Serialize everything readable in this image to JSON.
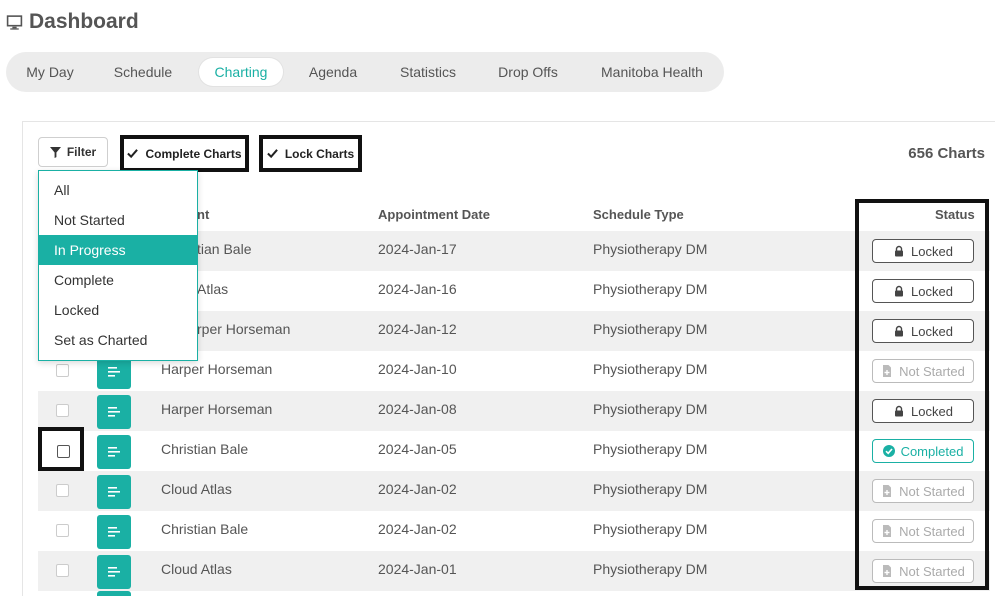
{
  "header": {
    "title": "Dashboard",
    "icon": "monitor-icon"
  },
  "tabs": [
    {
      "label": "My Day",
      "active": false
    },
    {
      "label": "Schedule",
      "active": false
    },
    {
      "label": "Charting",
      "active": true
    },
    {
      "label": "Agenda",
      "active": false
    },
    {
      "label": "Statistics",
      "active": false
    },
    {
      "label": "Drop Offs",
      "active": false
    },
    {
      "label": "Manitoba Health",
      "active": false
    }
  ],
  "toolbar": {
    "filter_label": "Filter",
    "complete_charts_label": "Complete Charts",
    "lock_charts_label": "Lock Charts",
    "chart_count": "656 Charts"
  },
  "filter_menu": {
    "options": [
      "All",
      "Not Started",
      "In Progress",
      "Complete",
      "Locked",
      "Set as Charted"
    ],
    "selected": "In Progress"
  },
  "table": {
    "columns": {
      "patient": "nt",
      "appointment_date": "Appointment Date",
      "schedule_type": "Schedule Type",
      "status": "Status"
    },
    "rows": [
      {
        "patient": "tian Bale",
        "date": "2024-Jan-17",
        "schedule": "Physiotherapy DM",
        "status": "Locked"
      },
      {
        "patient": "Atlas",
        "date": "2024-Jan-16",
        "schedule": "Physiotherapy DM",
        "status": "Locked"
      },
      {
        "patient": "rper Horseman",
        "date": "2024-Jan-12",
        "schedule": "Physiotherapy DM",
        "status": "Locked"
      },
      {
        "patient": "Harper Horseman",
        "date": "2024-Jan-10",
        "schedule": "Physiotherapy DM",
        "status": "Not Started"
      },
      {
        "patient": "Harper Horseman",
        "date": "2024-Jan-08",
        "schedule": "Physiotherapy DM",
        "status": "Locked"
      },
      {
        "patient": "Christian Bale",
        "date": "2024-Jan-05",
        "schedule": "Physiotherapy DM",
        "status": "Completed"
      },
      {
        "patient": "Cloud Atlas",
        "date": "2024-Jan-02",
        "schedule": "Physiotherapy DM",
        "status": "Not Started"
      },
      {
        "patient": "Christian Bale",
        "date": "2024-Jan-02",
        "schedule": "Physiotherapy DM",
        "status": "Not Started"
      },
      {
        "patient": "Cloud Atlas",
        "date": "2024-Jan-01",
        "schedule": "Physiotherapy DM",
        "status": "Not Started"
      }
    ]
  },
  "colors": {
    "accent": "#1ab0a4",
    "highlight_border": "#111111"
  }
}
